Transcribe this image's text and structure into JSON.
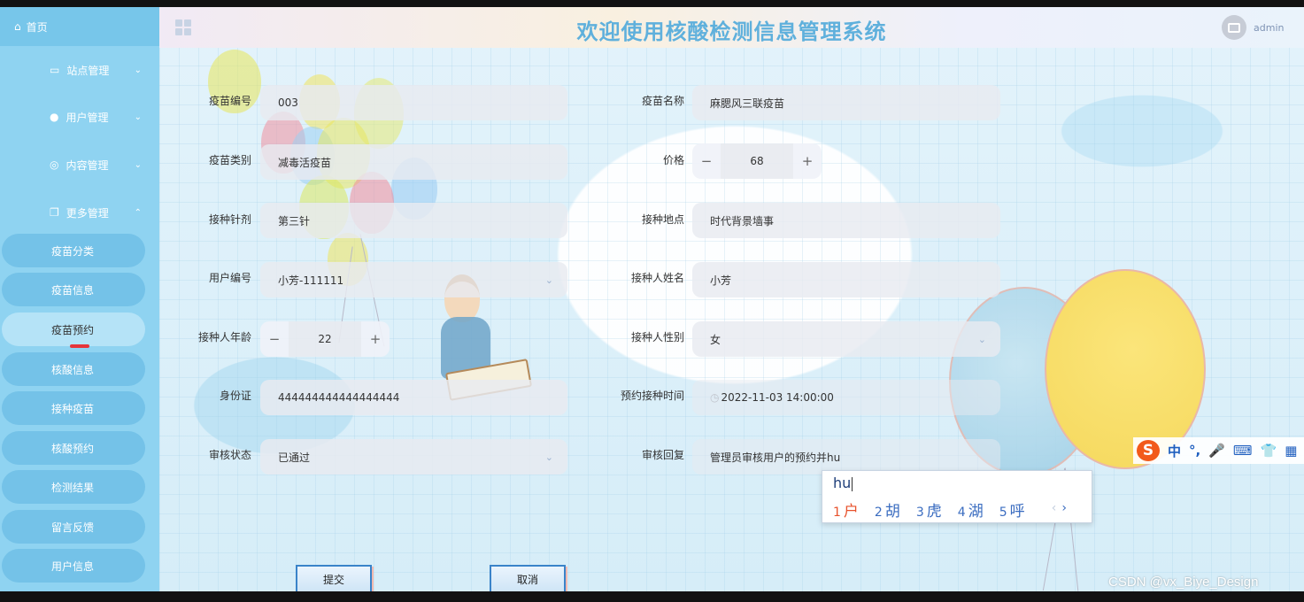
{
  "colors": {
    "sidebar": "#8fd3f1",
    "title": "#5fb0dc",
    "accent_red": "#e6343a",
    "ime_orange": "#f25a1b"
  },
  "sidebar": {
    "home": {
      "icon": "home-icon",
      "label": "首页"
    },
    "menus": [
      {
        "icon": "display-icon",
        "label": "站点管理",
        "chevron": "⌄"
      },
      {
        "icon": "user-icon",
        "label": "用户管理",
        "chevron": "⌄"
      },
      {
        "icon": "chat-icon",
        "label": "内容管理",
        "chevron": "⌄"
      },
      {
        "icon": "copy-icon",
        "label": "更多管理",
        "chevron": "⌃"
      }
    ],
    "subitems": [
      {
        "label": "疫苗分类"
      },
      {
        "label": "疫苗信息"
      },
      {
        "label": "疫苗预约"
      },
      {
        "label": "核酸信息"
      },
      {
        "label": "接种疫苗"
      },
      {
        "label": "核酸预约"
      },
      {
        "label": "检测结果"
      },
      {
        "label": "留言反馈"
      },
      {
        "label": "用户信息"
      }
    ],
    "active_index": 2
  },
  "header": {
    "title": "欢迎使用核酸检测信息管理系统",
    "username": "admin"
  },
  "form": {
    "vaccine_no": {
      "label": "疫苗编号",
      "value": "003"
    },
    "vaccine_name": {
      "label": "疫苗名称",
      "value": "麻腮风三联疫苗"
    },
    "vaccine_type": {
      "label": "疫苗类别",
      "value": "减毒活疫苗"
    },
    "price": {
      "label": "价格",
      "value": "68",
      "minus": "−",
      "plus": "+"
    },
    "dose": {
      "label": "接种针剂",
      "value": "第三针"
    },
    "location": {
      "label": "接种地点",
      "value": "时代背景墙事"
    },
    "user_no": {
      "label": "用户编号",
      "value": "小芳-111111",
      "arrow": "⌄"
    },
    "person_name": {
      "label": "接种人姓名",
      "value": "小芳"
    },
    "age": {
      "label": "接种人年龄",
      "value": "22",
      "minus": "−",
      "plus": "+"
    },
    "gender": {
      "label": "接种人性别",
      "value": "女",
      "arrow": "⌄"
    },
    "id_card": {
      "label": "身份证",
      "value": "444444444444444444"
    },
    "appointment_time": {
      "label": "预约接种时间",
      "value": "2022-11-03 14:00:00",
      "clock": "◷"
    },
    "review_status": {
      "label": "审核状态",
      "value": "已通过",
      "arrow": "⌄"
    },
    "review_reply": {
      "label": "审核回复",
      "value": "管理员审核用户的预约并hu"
    }
  },
  "buttons": {
    "submit": "提交",
    "cancel": "取消"
  },
  "ime": {
    "input": "hu",
    "candidates": [
      {
        "num": "1",
        "text": "户"
      },
      {
        "num": "2",
        "text": "胡"
      },
      {
        "num": "3",
        "text": "虎"
      },
      {
        "num": "4",
        "text": "湖"
      },
      {
        "num": "5",
        "text": "呼"
      }
    ],
    "prev": "‹",
    "next": "›",
    "toolbar": {
      "logo": "S",
      "mode": "中",
      "punct": "°,",
      "mic": "🎤",
      "keyboard": "⌨",
      "skin": "👕",
      "apps": "▦"
    }
  },
  "watermark": "CSDN @vx_Biye_Design"
}
